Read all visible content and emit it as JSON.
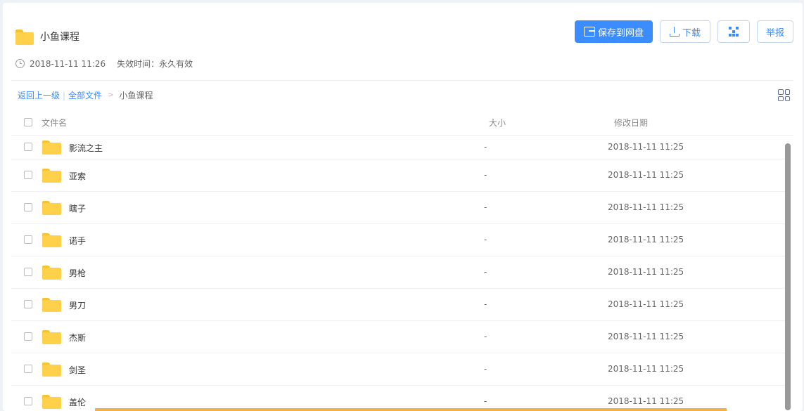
{
  "header": {
    "title": "小鱼课程",
    "created": "2018-11-11 11:26",
    "expire": "失效时间：永久有效"
  },
  "toolbar": {
    "save_label": "保存到网盘",
    "download_label": "下载",
    "report_label": "举报"
  },
  "breadcrumb": {
    "back": "返回上一级",
    "separator": "|",
    "all": "全部文件",
    "arrow": ">",
    "current": "小鱼课程"
  },
  "table": {
    "columns": {
      "name": "文件名",
      "size": "大小",
      "date": "修改日期"
    },
    "rows": [
      {
        "name": "影流之主",
        "size": "-",
        "date": "2018-11-11 11:25"
      },
      {
        "name": "亚索",
        "size": "-",
        "date": "2018-11-11 11:25"
      },
      {
        "name": "瞎子",
        "size": "-",
        "date": "2018-11-11 11:25"
      },
      {
        "name": "诺手",
        "size": "-",
        "date": "2018-11-11 11:25"
      },
      {
        "name": "男枪",
        "size": "-",
        "date": "2018-11-11 11:25"
      },
      {
        "name": "男刀",
        "size": "-",
        "date": "2018-11-11 11:25"
      },
      {
        "name": "杰斯",
        "size": "-",
        "date": "2018-11-11 11:25"
      },
      {
        "name": "剑圣",
        "size": "-",
        "date": "2018-11-11 11:25"
      },
      {
        "name": "盖伦",
        "size": "-",
        "date": "2018-11-11 11:25"
      }
    ]
  },
  "icons": {
    "folder": "folder-icon",
    "clock": "clock-icon",
    "save": "save-to-disk-icon",
    "download": "download-icon",
    "qr": "qr-code-icon",
    "grid_view": "grid-view-icon"
  },
  "colors": {
    "accent": "#3b8cff",
    "folder": "#ffd04a",
    "bottom_bar": "#f3b04a"
  }
}
